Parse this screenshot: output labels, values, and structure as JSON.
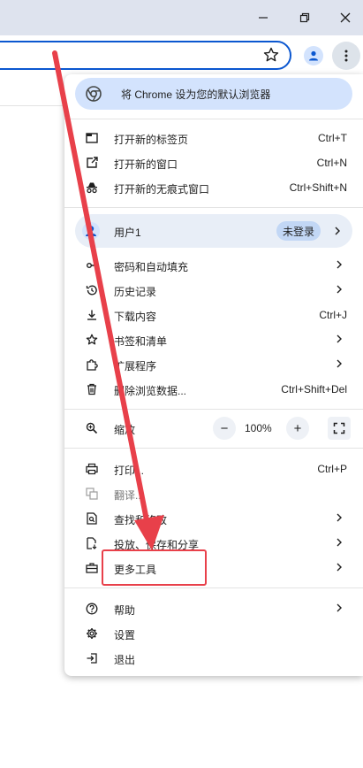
{
  "window": {
    "minimize_icon": "minimize-icon",
    "restore_icon": "restore-icon",
    "close_icon": "close-icon"
  },
  "toolbar": {
    "star_icon": "bookmark-star-icon",
    "profile_icon": "profile-icon",
    "menu_icon": "kebab-menu-icon"
  },
  "menu": {
    "default_banner": "将 Chrome 设为您的默认浏览器",
    "group1": [
      {
        "label": "打开新的标签页",
        "shortcut": "Ctrl+T",
        "icon": "new-tab-icon"
      },
      {
        "label": "打开新的窗口",
        "shortcut": "Ctrl+N",
        "icon": "new-window-icon"
      },
      {
        "label": "打开新的无痕式窗口",
        "shortcut": "Ctrl+Shift+N",
        "icon": "incognito-icon"
      }
    ],
    "user": {
      "name": "用户1",
      "status": "未登录"
    },
    "group2": [
      {
        "label": "密码和自动填充",
        "icon": "key-icon"
      },
      {
        "label": "历史记录",
        "icon": "history-icon"
      },
      {
        "label": "下载内容",
        "shortcut": "Ctrl+J",
        "icon": "download-icon"
      },
      {
        "label": "书签和清单",
        "icon": "star-icon"
      },
      {
        "label": "扩展程序",
        "icon": "extension-icon"
      },
      {
        "label": "删除浏览数据...",
        "shortcut": "Ctrl+Shift+Del",
        "icon": "trash-icon"
      }
    ],
    "zoom": {
      "label": "缩放",
      "value": "100%",
      "minus": "−",
      "plus": "+"
    },
    "group3": [
      {
        "label": "打印...",
        "shortcut": "Ctrl+P",
        "icon": "print-icon"
      },
      {
        "label": "翻译...",
        "icon": "translate-icon"
      },
      {
        "label": "查找和修改",
        "icon": "find-icon"
      },
      {
        "label": "投放、保存和分享",
        "icon": "cast-save-icon"
      },
      {
        "label": "更多工具",
        "icon": "toolbox-icon"
      }
    ],
    "group4": [
      {
        "label": "帮助",
        "icon": "help-icon"
      },
      {
        "label": "设置",
        "icon": "settings-icon"
      },
      {
        "label": "退出",
        "icon": "exit-icon"
      }
    ]
  },
  "annotation": {
    "color": "#e8404a"
  }
}
